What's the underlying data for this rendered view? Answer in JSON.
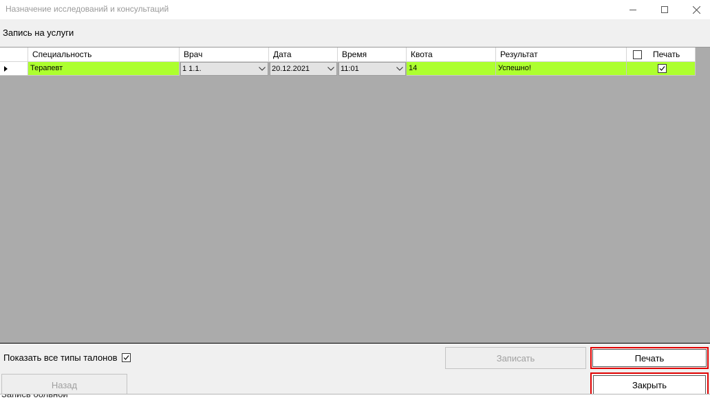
{
  "window": {
    "title": "Назначение исследований и консультаций",
    "minimize_icon": "minimize-icon",
    "maximize_icon": "maximize-icon",
    "close_icon": "close-icon"
  },
  "section": {
    "label": "Запись на услуги"
  },
  "grid": {
    "columns": [
      "Специальность",
      "Врач",
      "Дата",
      "Время",
      "Квота",
      "Результат",
      "Печать"
    ],
    "rows": [
      {
        "specialty": "Терапевт",
        "doctor": "1 1.1.",
        "date": "20.12.2021",
        "time": "11:01",
        "quota": "14",
        "result": "Успешно!",
        "print_checked": true
      }
    ],
    "header_print_checked": false,
    "row_color": "#adff2f",
    "background": "#ababab"
  },
  "footer": {
    "show_all_types_label": "Показать все типы талонов",
    "show_all_types_checked": true,
    "save_label": "Записать",
    "print_label": "Печать",
    "back_label": "Назад",
    "close_label": "Закрыть",
    "highlight_color": "#e00000"
  },
  "background_window": {
    "peek_text": "Запись больной"
  }
}
